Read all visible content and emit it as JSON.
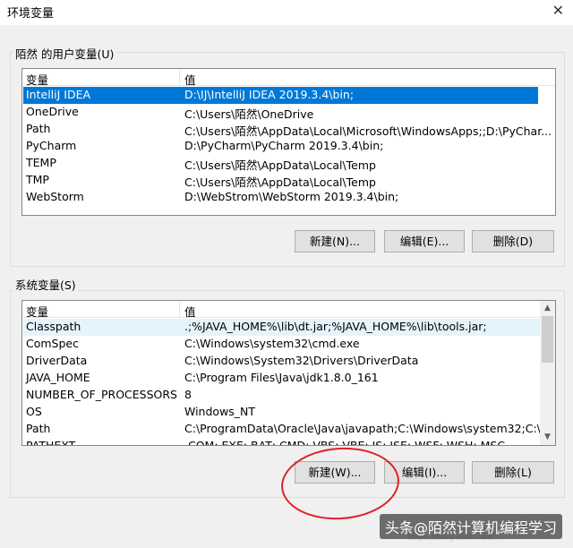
{
  "window": {
    "title": "环境变量"
  },
  "user_vars": {
    "group_label": "陌然 的用户变量(U)",
    "columns": [
      "变量",
      "值"
    ],
    "rows": [
      {
        "name": "IntelliJ IDEA",
        "value": "D:\\IJ\\IntelliJ IDEA 2019.3.4\\bin;"
      },
      {
        "name": "OneDrive",
        "value": "C:\\Users\\陌然\\OneDrive"
      },
      {
        "name": "Path",
        "value": "C:\\Users\\陌然\\AppData\\Local\\Microsoft\\WindowsApps;;D:\\PyChar..."
      },
      {
        "name": "PyCharm",
        "value": "D:\\PyCharm\\PyCharm 2019.3.4\\bin;"
      },
      {
        "name": "TEMP",
        "value": "C:\\Users\\陌然\\AppData\\Local\\Temp"
      },
      {
        "name": "TMP",
        "value": "C:\\Users\\陌然\\AppData\\Local\\Temp"
      },
      {
        "name": "WebStorm",
        "value": "D:\\WebStrom\\WebStorm 2019.3.4\\bin;"
      }
    ],
    "buttons": {
      "new": "新建(N)...",
      "edit": "编辑(E)...",
      "delete": "删除(D)"
    }
  },
  "system_vars": {
    "group_label": "系统变量(S)",
    "columns": [
      "变量",
      "值"
    ],
    "rows": [
      {
        "name": "Classpath",
        "value": ".;%JAVA_HOME%\\lib\\dt.jar;%JAVA_HOME%\\lib\\tools.jar;"
      },
      {
        "name": "ComSpec",
        "value": "C:\\Windows\\system32\\cmd.exe"
      },
      {
        "name": "DriverData",
        "value": "C:\\Windows\\System32\\Drivers\\DriverData"
      },
      {
        "name": "JAVA_HOME",
        "value": "C:\\Program Files\\Java\\jdk1.8.0_161"
      },
      {
        "name": "NUMBER_OF_PROCESSORS",
        "value": "8"
      },
      {
        "name": "OS",
        "value": "Windows_NT"
      },
      {
        "name": "Path",
        "value": "C:\\ProgramData\\Oracle\\Java\\javapath;C:\\Windows\\system32;C:\\Wi..."
      },
      {
        "name": "PATHEXT",
        "value": ".COM;.EXE;.BAT;.CMD;.VBS;.VBE;.JS;.JSE;.WSF;.WSH;.MSC"
      }
    ],
    "buttons": {
      "new": "新建(W)...",
      "edit": "编辑(I)...",
      "delete": "删除(L)"
    }
  },
  "watermark": {
    "text": "头条@陌然计算机编程学习",
    "url": "https://blog.csdn.net/..."
  },
  "colors": {
    "selection": "#0078d7",
    "annotation": "#e0202a"
  }
}
